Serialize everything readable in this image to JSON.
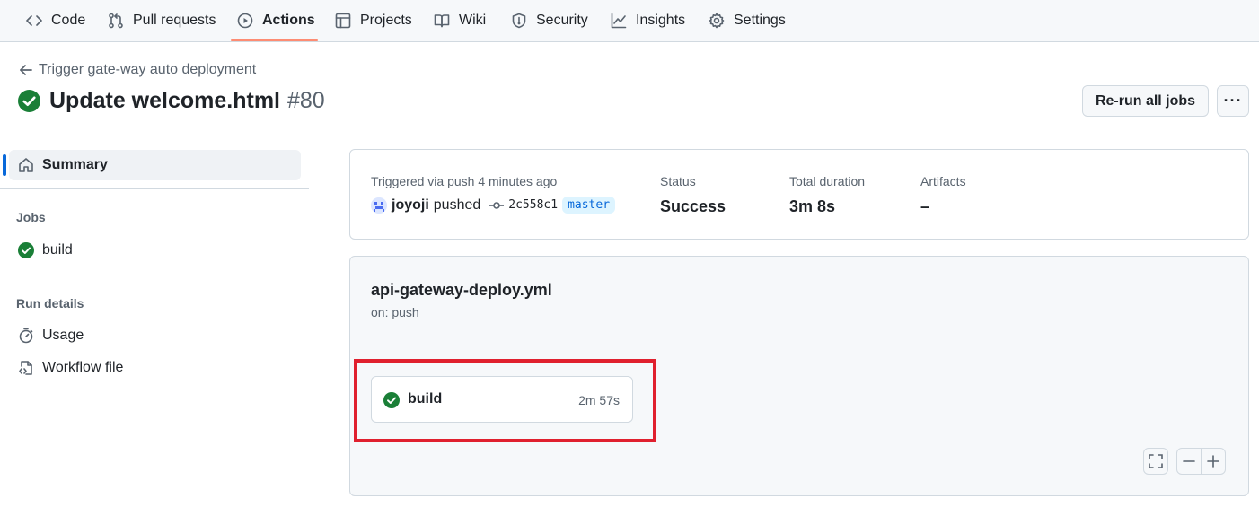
{
  "nav": {
    "tabs": [
      {
        "label": "Code",
        "icon": "code-icon"
      },
      {
        "label": "Pull requests",
        "icon": "git-pull-request-icon"
      },
      {
        "label": "Actions",
        "icon": "play-icon",
        "active": true
      },
      {
        "label": "Projects",
        "icon": "table-icon"
      },
      {
        "label": "Wiki",
        "icon": "book-icon"
      },
      {
        "label": "Security",
        "icon": "shield-icon"
      },
      {
        "label": "Insights",
        "icon": "graph-icon"
      },
      {
        "label": "Settings",
        "icon": "gear-icon"
      }
    ],
    "active_underline_color": "#fd8c73"
  },
  "header": {
    "back_label": "Trigger gate-way auto deployment",
    "title": "Update welcome.html",
    "run_number": "#80",
    "rerun_label": "Re-run all jobs",
    "more_label": "···"
  },
  "sidebar": {
    "summary_label": "Summary",
    "jobs_heading": "Jobs",
    "jobs": [
      {
        "label": "build",
        "status": "success"
      }
    ],
    "run_details_heading": "Run details",
    "run_details": [
      {
        "label": "Usage",
        "icon": "stopwatch-icon"
      },
      {
        "label": "Workflow file",
        "icon": "file-code-icon"
      }
    ]
  },
  "summary": {
    "trigger_label": "Triggered via push 4 minutes ago",
    "user": "joyoji",
    "action": "pushed",
    "commit_sha": "2c558c1",
    "branch": "master",
    "status_label": "Status",
    "status_value": "Success",
    "duration_label": "Total duration",
    "duration_value": "3m 8s",
    "artifacts_label": "Artifacts",
    "artifacts_value": "–"
  },
  "workflow": {
    "file_name": "api-gateway-deploy.yml",
    "trigger": "on: push",
    "job": {
      "name": "build",
      "duration": "2m 57s",
      "status": "success"
    }
  },
  "colors": {
    "success_green": "#1a7f37",
    "accent_blue": "#0969da",
    "highlight_red": "#e0202e"
  }
}
